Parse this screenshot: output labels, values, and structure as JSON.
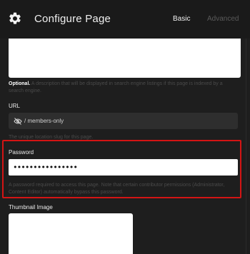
{
  "header": {
    "title": "Configure Page",
    "tabs": [
      {
        "label": "Basic",
        "active": true
      },
      {
        "label": "Advanced",
        "active": false
      }
    ],
    "icon": "gear-icon"
  },
  "description": {
    "value": "",
    "help_strong": "Optional.",
    "help_text": " A description that will be displayed in search engine listings if this page is indexed by a search engine."
  },
  "url": {
    "label": "URL",
    "prefix": "/",
    "value": "members-only",
    "icon": "eye-off-icon",
    "help": "The unique location slug for this page."
  },
  "password": {
    "label": "Password",
    "value": "••••••••••••••••",
    "help": "A password required to access this page. Note that certain contributor permissions (Administrator, Content Editor) automatically bypass this password.",
    "highlight_color": "#d41414"
  },
  "thumbnail": {
    "label": "Thumbnail Image"
  }
}
